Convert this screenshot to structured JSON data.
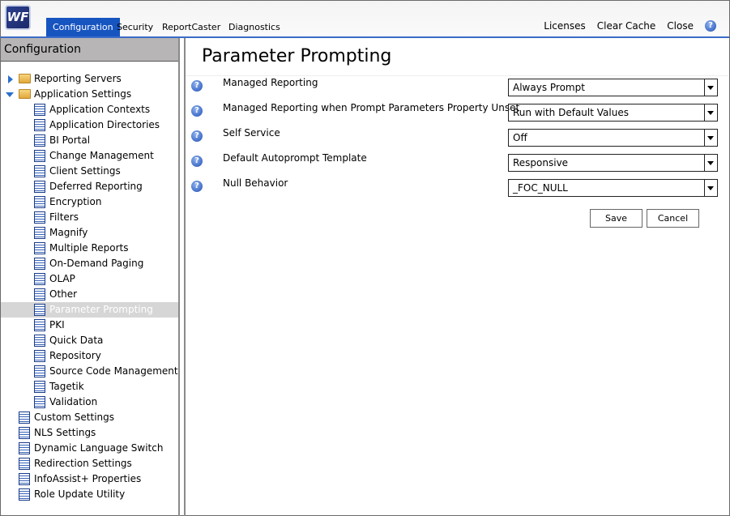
{
  "header": {
    "logo": "WF",
    "tabs": [
      "Configuration",
      "Security",
      "ReportCaster",
      "Diagnostics"
    ],
    "links": [
      "Licenses",
      "Clear Cache",
      "Close"
    ]
  },
  "sidebar": {
    "title": "Configuration",
    "items": [
      {
        "label": "Reporting Servers",
        "level": 0,
        "type": "folder",
        "state": "collapsed"
      },
      {
        "label": "Application Settings",
        "level": 0,
        "type": "folder",
        "state": "expanded"
      },
      {
        "label": "Application Contexts",
        "level": 1
      },
      {
        "label": "Application Directories",
        "level": 1
      },
      {
        "label": "BI Portal",
        "level": 1
      },
      {
        "label": "Change Management",
        "level": 1
      },
      {
        "label": "Client Settings",
        "level": 1
      },
      {
        "label": "Deferred Reporting",
        "level": 1
      },
      {
        "label": "Encryption",
        "level": 1
      },
      {
        "label": "Filters",
        "level": 1
      },
      {
        "label": "Magnify",
        "level": 1
      },
      {
        "label": "Multiple Reports",
        "level": 1
      },
      {
        "label": "On-Demand Paging",
        "level": 1
      },
      {
        "label": "OLAP",
        "level": 1
      },
      {
        "label": "Other",
        "level": 1
      },
      {
        "label": "Parameter Prompting",
        "level": 1,
        "selected": true
      },
      {
        "label": "PKI",
        "level": 1
      },
      {
        "label": "Quick Data",
        "level": 1
      },
      {
        "label": "Repository",
        "level": 1
      },
      {
        "label": "Source Code Management",
        "level": 1
      },
      {
        "label": "Tagetik",
        "level": 1
      },
      {
        "label": "Validation",
        "level": 1
      },
      {
        "label": "Custom Settings",
        "level": 0
      },
      {
        "label": "NLS Settings",
        "level": 0
      },
      {
        "label": "Dynamic Language Switch",
        "level": 0
      },
      {
        "label": "Redirection Settings",
        "level": 0
      },
      {
        "label": "InfoAssist+ Properties",
        "level": 0
      },
      {
        "label": "Role Update Utility",
        "level": 0
      }
    ]
  },
  "main": {
    "title": "Parameter Prompting",
    "settings": [
      {
        "label": "Managed Reporting",
        "value": "Always Prompt"
      },
      {
        "label": "Managed Reporting when Prompt Parameters Property Unset",
        "value": "Run with Default Values"
      },
      {
        "label": "Self Service",
        "value": "Off"
      },
      {
        "label": "Default Autoprompt Template",
        "value": "Responsive"
      },
      {
        "label": "Null Behavior",
        "value": "_FOC_NULL"
      }
    ],
    "save_label": "Save",
    "cancel_label": "Cancel"
  }
}
